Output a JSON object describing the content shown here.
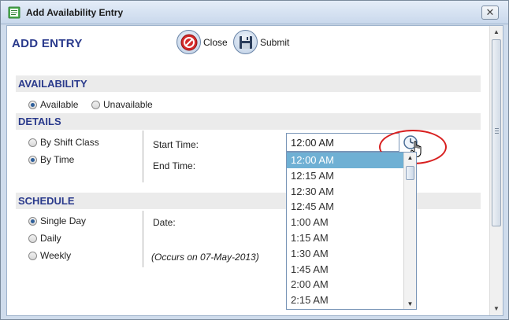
{
  "window": {
    "title": "Add Availability Entry",
    "close_glyph": "✕"
  },
  "header": {
    "title": "ADD ENTRY"
  },
  "toolbar": {
    "close_label": "Close",
    "submit_label": "Submit"
  },
  "availability": {
    "section_label": "AVAILABILITY",
    "options": [
      {
        "label": "Available",
        "selected": true
      },
      {
        "label": "Unavailable",
        "selected": false
      }
    ]
  },
  "details": {
    "section_label": "DETAILS",
    "options": [
      {
        "label": "By Shift Class",
        "selected": false
      },
      {
        "label": "By Time",
        "selected": true
      }
    ],
    "start_time_label": "Start Time:",
    "start_time_value": "12:00 AM",
    "end_time_label": "End Time:"
  },
  "time_dropdown": {
    "items": [
      "12:00 AM",
      "12:15 AM",
      "12:30 AM",
      "12:45 AM",
      "1:00 AM",
      "1:15 AM",
      "1:30 AM",
      "1:45 AM",
      "2:00 AM",
      "2:15 AM"
    ],
    "selected_index": 0
  },
  "schedule": {
    "section_label": "SCHEDULE",
    "options": [
      {
        "label": "Single Day",
        "selected": true
      },
      {
        "label": "Daily",
        "selected": false
      },
      {
        "label": "Weekly",
        "selected": false
      }
    ],
    "date_label": "Date:",
    "occurs_note": "(Occurs on 07-May-2013)"
  },
  "colors": {
    "section_text": "#2a3a8c",
    "selection": "#6fb0d4",
    "highlight_ring": "#d81f1f"
  },
  "icons": {
    "close": "close-icon",
    "submit": "save-disk-icon",
    "clock": "clock-icon",
    "cursor": "hand-cursor-icon"
  }
}
